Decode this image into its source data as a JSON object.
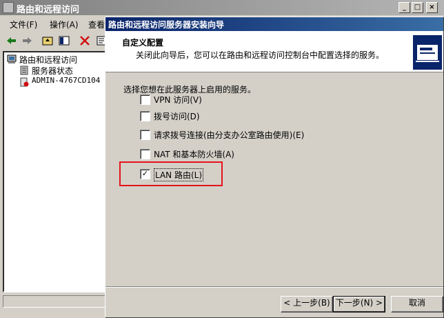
{
  "main_window": {
    "title": "路由和远程访问",
    "controls": [
      "_",
      "□",
      "×"
    ]
  },
  "menubar": {
    "items": [
      "文件(F)",
      "操作(A)",
      "查看"
    ]
  },
  "toolbar": {
    "icons": [
      "back-arrow-icon",
      "forward-arrow-icon",
      "up-folder-icon",
      "show-hide-tree-icon",
      "delete-icon",
      "properties-icon"
    ]
  },
  "tree": {
    "root": "路由和远程访问",
    "items": [
      "服务器状态",
      "ADMIN-4767CD104 ("
    ]
  },
  "wizard": {
    "title": "路由和远程访问服务器安装向导",
    "header_title": "自定义配置",
    "header_subtitle": "关闭此向导后，您可以在路由和远程访问控制台中配置选择的服务。",
    "prompt": "选择您想在此服务器上启用的服务。",
    "options": [
      {
        "label": "VPN 访问(V)",
        "checked": false
      },
      {
        "label": "拨号访问(D)",
        "checked": false
      },
      {
        "label": "请求拨号连接(由分支办公室路由使用)(E)",
        "checked": false
      },
      {
        "label": "NAT 和基本防火墙(A)",
        "checked": false
      },
      {
        "label": "LAN 路由(L)",
        "checked": true
      }
    ],
    "buttons": {
      "back": "< 上一步(B)",
      "next": "下一步(N) >",
      "cancel": "取消"
    },
    "highlight_color": "#e5131b"
  }
}
